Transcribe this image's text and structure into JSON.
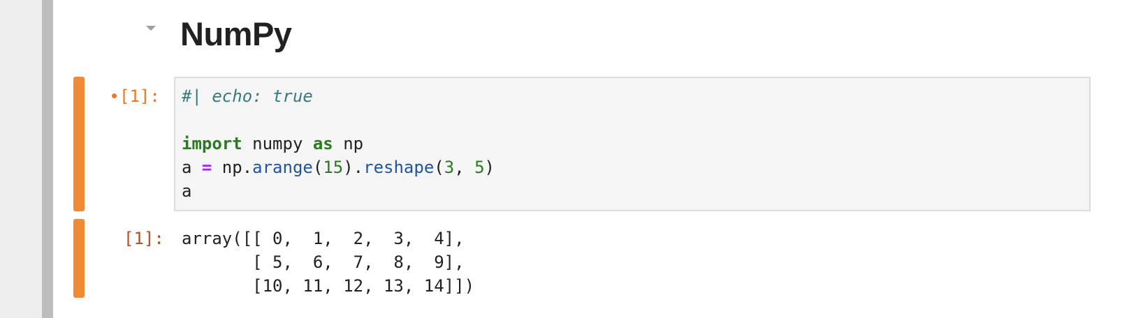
{
  "heading": {
    "title": "NumPy",
    "collapse_icon": "caret-down-icon"
  },
  "input_cell": {
    "prompt": "[1]:",
    "modified": true,
    "code_lines": [
      [
        {
          "text": "#| echo: true",
          "type": "comment"
        }
      ],
      [],
      [
        {
          "text": "import",
          "type": "keyword"
        },
        {
          "text": " numpy ",
          "type": "plain"
        },
        {
          "text": "as",
          "type": "keyword"
        },
        {
          "text": " np",
          "type": "plain"
        }
      ],
      [
        {
          "text": "a ",
          "type": "plain"
        },
        {
          "text": "=",
          "type": "operator"
        },
        {
          "text": " np.",
          "type": "plain"
        },
        {
          "text": "arange",
          "type": "func"
        },
        {
          "text": "(",
          "type": "plain"
        },
        {
          "text": "15",
          "type": "number"
        },
        {
          "text": ").",
          "type": "plain"
        },
        {
          "text": "reshape",
          "type": "func"
        },
        {
          "text": "(",
          "type": "plain"
        },
        {
          "text": "3",
          "type": "number"
        },
        {
          "text": ", ",
          "type": "plain"
        },
        {
          "text": "5",
          "type": "number"
        },
        {
          "text": ")",
          "type": "plain"
        }
      ],
      [
        {
          "text": "a",
          "type": "plain"
        }
      ]
    ]
  },
  "output_cell": {
    "prompt": "[1]:",
    "lines": [
      "array([[ 0,  1,  2,  3,  4],",
      "       [ 5,  6,  7,  8,  9],",
      "       [10, 11, 12, 13, 14]])"
    ]
  },
  "colors": {
    "accent_orange": "#f08a36",
    "prompt_input": "#e8792b",
    "prompt_output": "#b0502a",
    "editor_bg": "#f5f5f5",
    "comment": "#3a7b80",
    "keyword": "#2b7a20",
    "operator": "#aa22ff",
    "function": "#1f55a2"
  }
}
